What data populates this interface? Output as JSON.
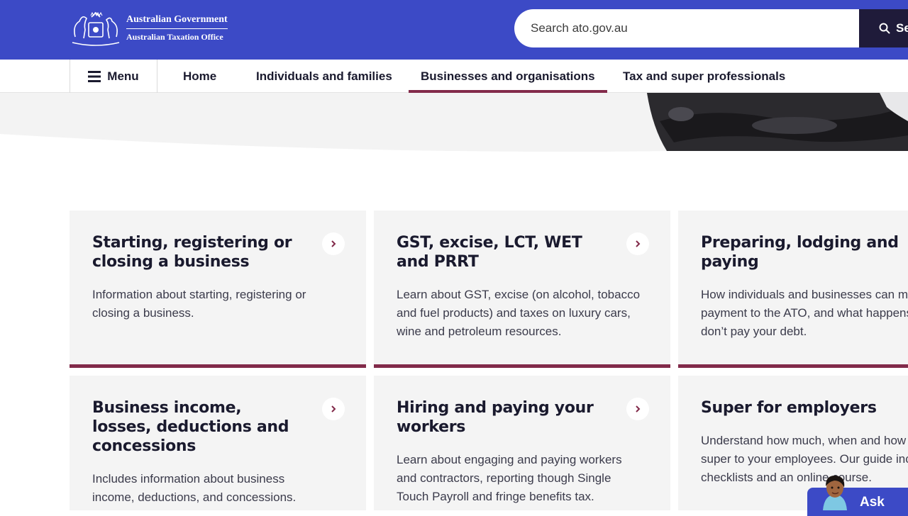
{
  "header": {
    "logo_line1": "Australian Government",
    "logo_line2": "Australian Taxation Office",
    "search_placeholder": "Search ato.gov.au",
    "search_button": "Se"
  },
  "nav": {
    "menu": "Menu",
    "items": [
      "Home",
      "Individuals and families",
      "Businesses and organisations",
      "Tax and super professionals"
    ],
    "active": "Businesses and organisations"
  },
  "cards": [
    {
      "title": "Starting, registering or closing a business",
      "desc": "Information about starting, registering or closing a business."
    },
    {
      "title": "GST, excise, LCT, WET and PRRT",
      "desc": "Learn about GST, excise (on alcohol, tobacco and fuel products) and taxes on luxury cars, wine and petroleum resources."
    },
    {
      "title": "Preparing, lodging and paying",
      "desc": "How individuals and businesses can make a payment to the ATO, and what happens if you don’t pay your debt."
    },
    {
      "title": "Business income, losses, deductions and concessions",
      "desc": "Includes information about business income, deductions, and concessions."
    },
    {
      "title": "Hiring and paying your workers",
      "desc": "Learn about engaging and paying workers and contractors, reporting though Single Touch Payroll and fringe benefits tax."
    },
    {
      "title": "Super for employers",
      "desc": "Understand how much, when and how to pay super to your employees. Our guide includes checklists and an online course."
    }
  ],
  "chat": {
    "label": "Ask"
  },
  "colors": {
    "brand_blue": "#3c4ac6",
    "accent_maroon": "#822a4a",
    "dark": "#1f1b3a",
    "card_bg": "#f4f4f4"
  }
}
